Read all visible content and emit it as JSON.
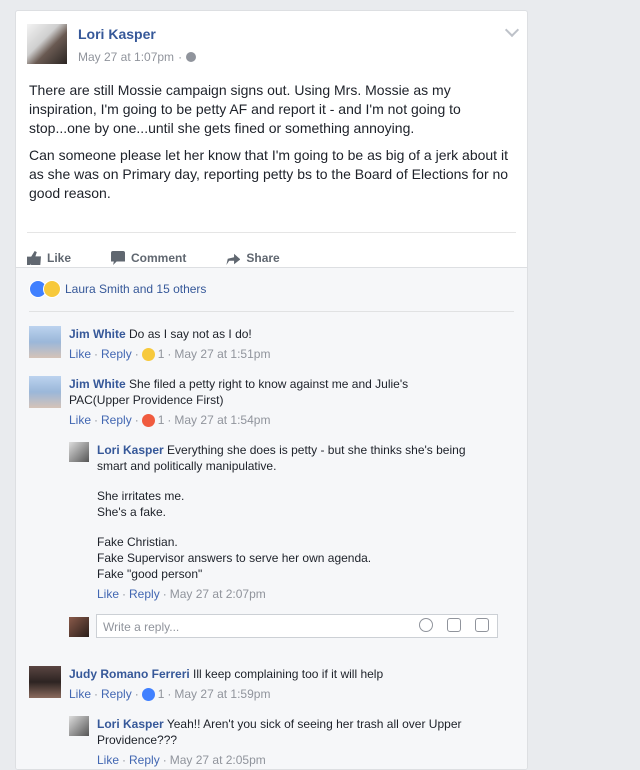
{
  "post": {
    "author": "Lori Kasper",
    "time": "May 27 at 1:07pm",
    "separator": "·",
    "paragraph1": "There are still Mossie campaign signs out. Using Mrs. Mossie as my inspiration, I'm going to be petty AF and report it - and I'm not going to stop...one by one...until she gets fined or something annoying.",
    "paragraph2": "Can someone please let her know that I'm going to be as big of a jerk about it as she was on Primary day, reporting petty bs to the Board of Elections for no good reason."
  },
  "actions": {
    "like": "Like",
    "comment": "Comment",
    "share": "Share"
  },
  "reactions": {
    "text": "Laura Smith and 15 others",
    "icons": [
      "like",
      "haha"
    ]
  },
  "comments": [
    {
      "name": "Jim White",
      "text": "Do as I say not as I do!",
      "like": "Like",
      "reply": "Reply",
      "reaction": "haha",
      "count": "1",
      "time": "May 27 at 1:51pm"
    },
    {
      "name": "Jim White",
      "text": "She filed a petty right to know against me and Julie's PAC(Upper Providence First)",
      "like": "Like",
      "reply": "Reply",
      "reaction": "angry",
      "count": "1",
      "time": "May 27 at 1:54pm"
    }
  ],
  "reply1": {
    "name": "Lori Kasper",
    "line1": "Everything she does is petty - but she thinks she's being smart and politically manipulative.",
    "line2a": "She irritates me.",
    "line2b": "She's a fake.",
    "line3a": "Fake Christian.",
    "line3b": "Fake Supervisor answers to serve her own agenda.",
    "line3c": "Fake \"good person\"",
    "like": "Like",
    "reply": "Reply",
    "time": "May 27 at 2:07pm"
  },
  "reply_box": {
    "placeholder": "Write a reply..."
  },
  "comment3": {
    "name": "Judy Romano Ferreri",
    "text": "Ill keep complaining too if it will help",
    "like": "Like",
    "reply": "Reply",
    "reaction": "like",
    "count": "1",
    "time": "May 27 at 1:59pm"
  },
  "reply2": {
    "name": "Lori Kasper",
    "text": "Yeah!! Aren't you sick of seeing her trash all over Upper Providence???",
    "like": "Like",
    "reply": "Reply",
    "time": "May 27 at 2:05pm"
  },
  "colors": {
    "link": "#365899",
    "meta": "#90949c",
    "background": "#e9ebee"
  }
}
